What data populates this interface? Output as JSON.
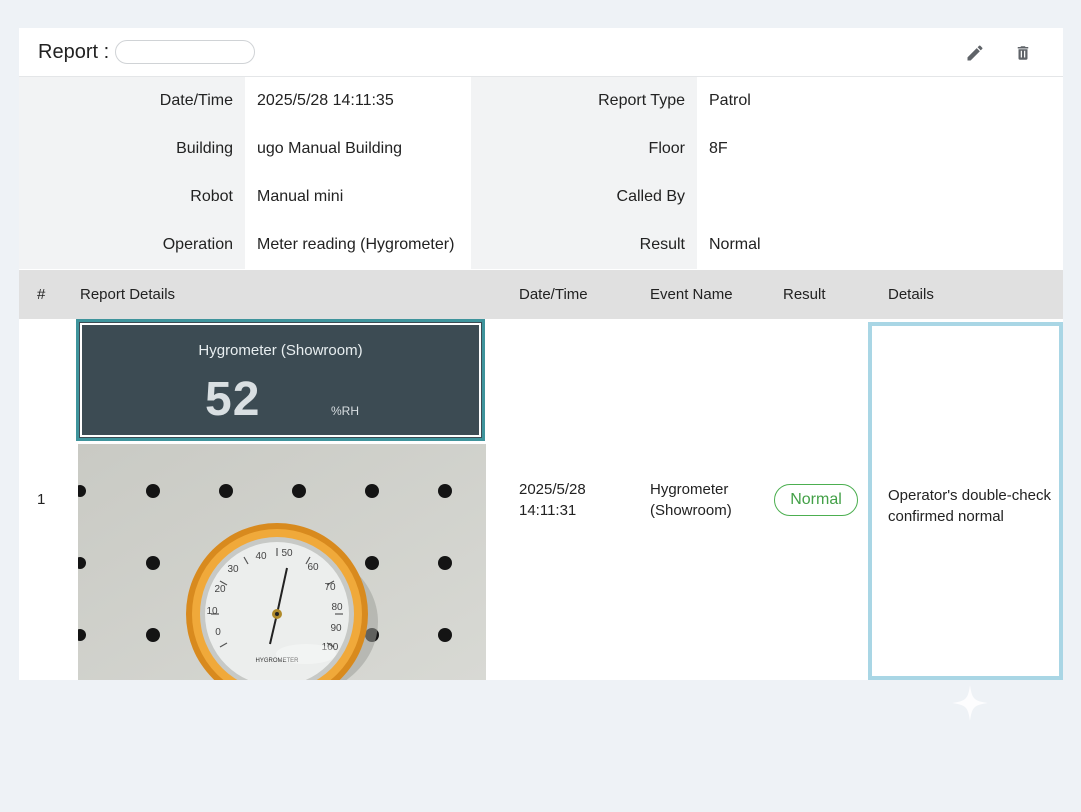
{
  "header": {
    "title": "Report :",
    "report_name_value": "",
    "edit_icon": "pencil-icon",
    "delete_icon": "trash-icon"
  },
  "info": {
    "datetime_label": "Date/Time",
    "datetime_value": "2025/5/28 14:11:35",
    "building_label": "Building",
    "building_value": "ugo Manual Building",
    "robot_label": "Robot",
    "robot_value": "Manual mini",
    "operation_label": "Operation",
    "operation_value": "Meter reading (Hygrometer)",
    "report_type_label": "Report Type",
    "report_type_value": "Patrol",
    "floor_label": "Floor",
    "floor_value": "8F",
    "called_by_label": "Called By",
    "called_by_value": "",
    "result_label": "Result",
    "result_value": "Normal"
  },
  "table": {
    "columns": [
      "#",
      "Report Details",
      "Date/Time",
      "Event Name",
      "Result",
      "Details"
    ],
    "rows": [
      {
        "index": "1",
        "reading": {
          "name": "Hygrometer (Showroom)",
          "value": "52",
          "unit": "%RH"
        },
        "datetime_line1": "2025/5/28",
        "datetime_line2": "14:11:31",
        "event_line1": "Hygrometer",
        "event_line2": "(Showroom)",
        "result": "Normal",
        "details_line1": "Operator's double-check",
        "details_line2": "confirmed normal"
      }
    ]
  },
  "colors": {
    "accent_teal": "#3f949c",
    "reading_bg": "#3c4b53",
    "status_green": "#4caf50",
    "details_highlight": "#a9d6e5",
    "gauge_orange": "#e89a2c"
  }
}
